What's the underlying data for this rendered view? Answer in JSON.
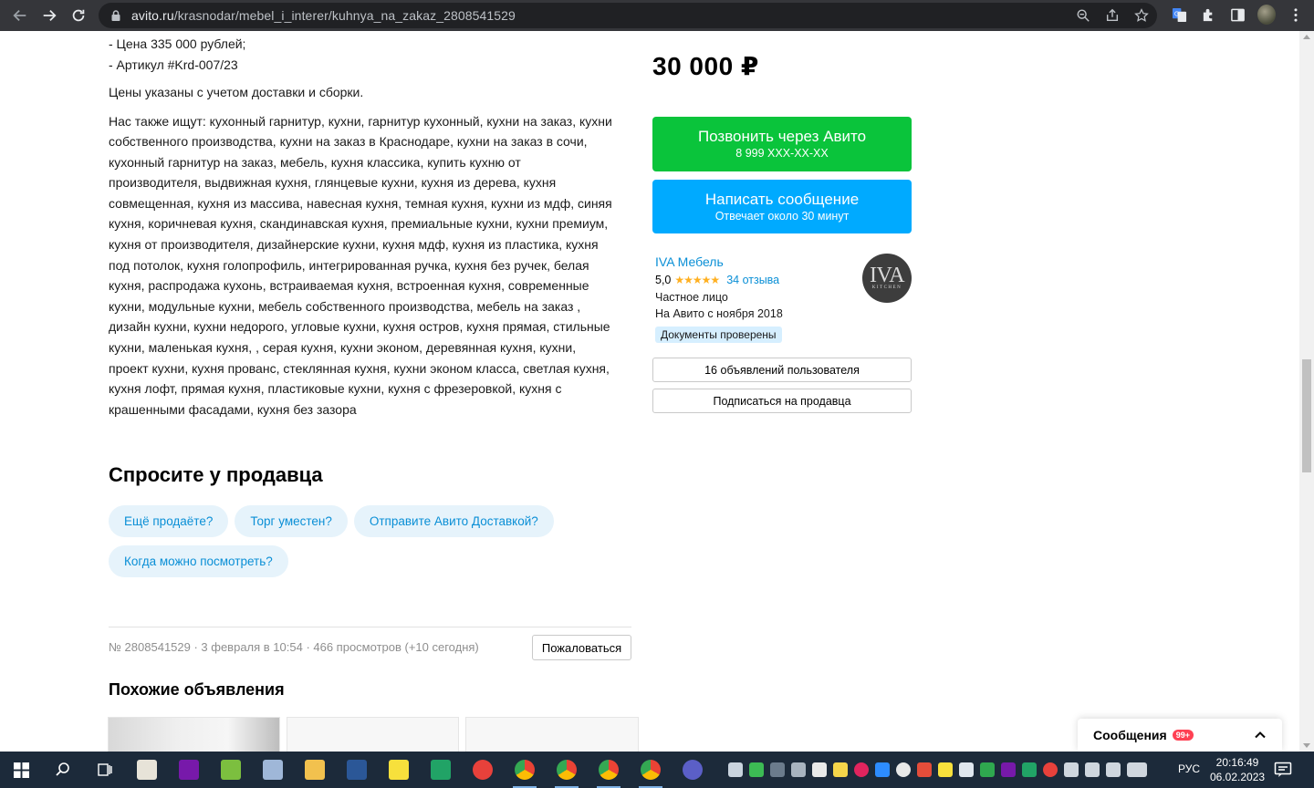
{
  "browser": {
    "url_host": "avito.ru",
    "url_path": "/krasnodar/mebel_i_interer/kuhnya_na_zakaz_2808541529"
  },
  "description": {
    "line_price": "- Цена 335 000 рублей;",
    "line_article": "- Артикул #Krd-007/23",
    "delivery_note": "Цены указаны с учетом доставки и сборки.",
    "tags": [
      "Нас также ищут: кухонный гарнитур, кухни, гарнитур кухонный, кухни на заказ, кухни",
      "собственного производства, кухни на заказ в Краснодаре, кухни на заказ в сочи,",
      "кухонный гарнитур на заказ, мебель, кухня классика, купить кухню от",
      "производителя, выдвижная кухня, глянцевые кухни, кухня из дерева, кухня",
      "совмещенная, кухня из массива, навесная кухня, темная кухня, кухни из мдф, синяя",
      "кухня, коричневая кухня, скандинавская кухня, премиальные кухни, кухни премиум,",
      "кухня от производителя, дизайнерские кухни, кухня мдф, кухня из пластика, кухня",
      "под потолок, кухня голопрофиль, интегрированная ручка, кухня без ручек, белая",
      "кухня, распродажа кухонь, встраиваемая кухня, встроенная кухня, современные",
      "кухни, модульные кухни, мебель собственного производства, мебель на заказ ,",
      "дизайн кухни, кухни недорого, угловые кухни, кухня остров, кухня прямая, стильные",
      "кухни, маленькая кухня, , серая кухня, кухни эконом, деревянная кухня, кухни,",
      "проект кухни, кухня прованс, стеклянная кухня, кухни эконом класса, светлая кухня,",
      "кухня лофт, прямая кухня, пластиковые кухни, кухня с фрезеровкой, кухня с",
      "крашенными фасадами, кухня без зазора"
    ]
  },
  "ask": {
    "title": "Спросите у продавца",
    "chips": [
      "Ещё продаёте?",
      "Торг уместен?",
      "Отправите Авито Доставкой?",
      "Когда можно посмотреть?"
    ]
  },
  "footer_meta": {
    "text": "№ 2808541529 · 3 февраля в 10:54 · 466 просмотров (+10 сегодня)",
    "report_label": "Пожаловаться"
  },
  "similar": {
    "title": "Похожие объявления",
    "cards": [
      "",
      "",
      ""
    ]
  },
  "sidebar": {
    "price": "30 000 ₽",
    "call_label": "Позвонить через Авито",
    "call_phone": "8 999 XXX-XX-XX",
    "message_label": "Написать сообщение",
    "message_sub": "Отвечает около 30 минут",
    "seller_name": "IVA Мебель",
    "rating": "5,0",
    "stars": "★★★★★",
    "reviews": "34 отзыва",
    "seller_type": "Частное лицо",
    "since": "На Авито с ноября 2018",
    "verified": "Документы проверены",
    "logo_main": "IVA",
    "logo_sub": "KITCHEN",
    "ads_button": "16 объявлений пользователя",
    "subscribe_button": "Подписаться на продавца"
  },
  "messages_widget": {
    "label": "Сообщения",
    "badge": "99+"
  },
  "taskbar": {
    "lang": "РУС",
    "time": "20:16:49",
    "date": "06.02.2023"
  },
  "colors": {
    "call_green": "#0ac43b",
    "message_blue": "#00aaff",
    "link_blue": "#0a8fd6",
    "chip_bg": "#e6f3fb",
    "star_yellow": "#ffb021"
  }
}
